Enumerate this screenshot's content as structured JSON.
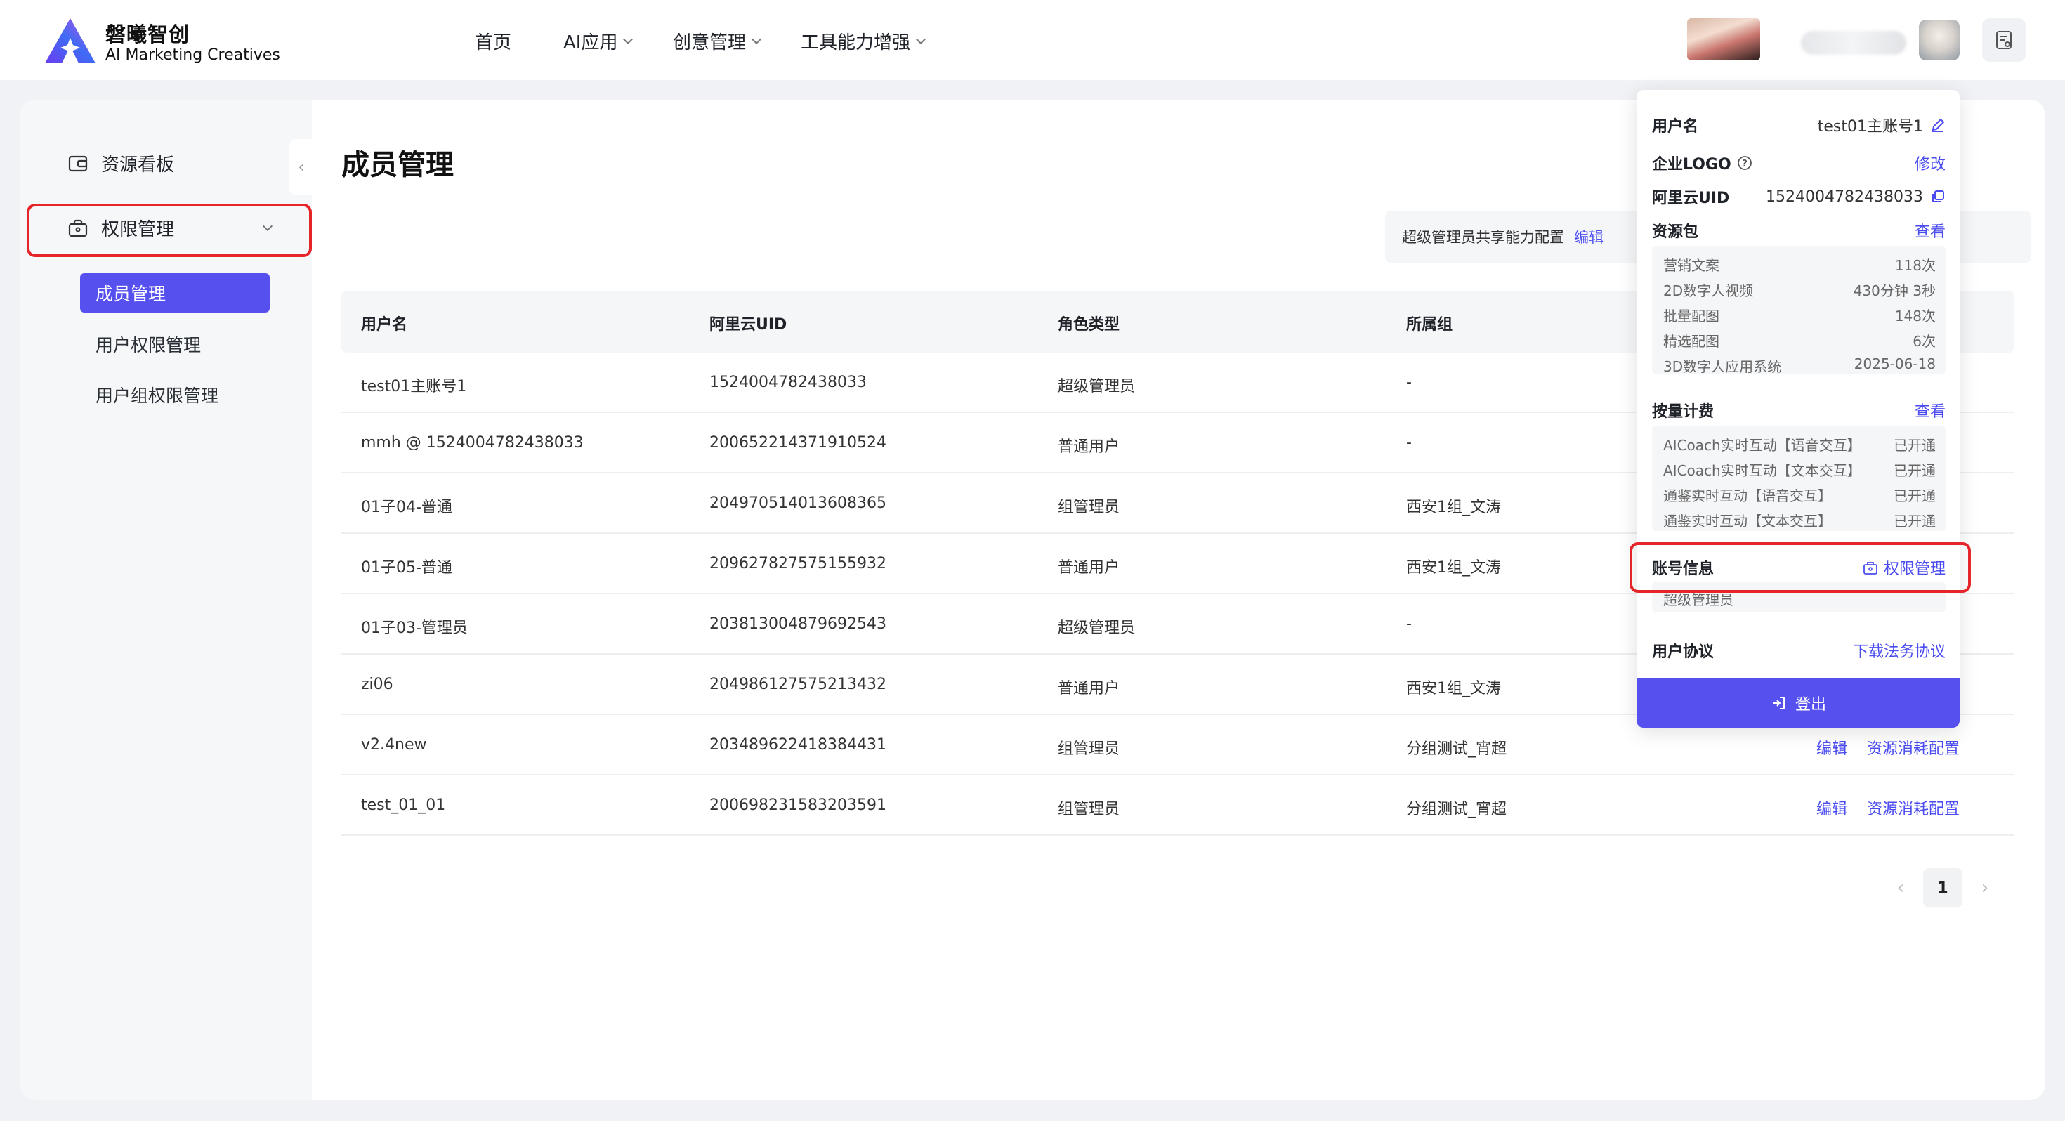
{
  "brand": {
    "name_cn": "磐曦智创",
    "name_en": "AI Marketing Creatives"
  },
  "nav": {
    "home": "首页",
    "ai_apps": "AI应用",
    "creative": "创意管理",
    "tools": "工具能力增强"
  },
  "sidebar": {
    "resource_board": "资源看板",
    "permission": "权限管理",
    "sub_items": [
      "成员管理",
      "用户权限管理",
      "用户组权限管理"
    ]
  },
  "page": {
    "title": "成员管理",
    "share_config": "超级管理员共享能力配置",
    "share_edit": "编辑"
  },
  "table": {
    "headers": [
      "用户名",
      "阿里云UID",
      "角色类型",
      "所属组"
    ],
    "rows": [
      {
        "user": "test01主账号1",
        "uid": "1524004782438033",
        "role": "超级管理员",
        "group": "-",
        "edit": "",
        "resource": ""
      },
      {
        "user": "mmh @ 1524004782438033",
        "uid": "200652214371910524",
        "role": "普通用户",
        "group": "-",
        "edit": "",
        "resource": ""
      },
      {
        "user": "01子04-普通",
        "uid": "204970514013608365",
        "role": "组管理员",
        "group": "西安1组_文涛",
        "edit": "",
        "resource": ""
      },
      {
        "user": "01子05-普通",
        "uid": "209627827575155932",
        "role": "普通用户",
        "group": "西安1组_文涛",
        "edit": "",
        "resource": ""
      },
      {
        "user": "01子03-管理员",
        "uid": "203813004879692543",
        "role": "超级管理员",
        "group": "-",
        "edit": "",
        "resource": ""
      },
      {
        "user": "zi06",
        "uid": "204986127575213432",
        "role": "普通用户",
        "group": "西安1组_文涛",
        "edit": "",
        "resource": ""
      },
      {
        "user": "v2.4new",
        "uid": "203489622418384431",
        "role": "组管理员",
        "group": "分组测试_宵超",
        "edit": "编辑",
        "resource": "资源消耗配置"
      },
      {
        "user": "test_01_01",
        "uid": "200698231583203591",
        "role": "组管理员",
        "group": "分组测试_宵超",
        "edit": "编辑",
        "resource": "资源消耗配置"
      }
    ]
  },
  "pagination": {
    "current": "1"
  },
  "dropdown": {
    "username_label": "用户名",
    "username_value": "test01主账号1",
    "logo_label": "企业LOGO",
    "logo_action": "修改",
    "uid_label": "阿里云UID",
    "uid_value": "1524004782438033",
    "resource_label": "资源包",
    "resource_action": "查看",
    "resources": [
      {
        "name": "营销文案",
        "value": "118次"
      },
      {
        "name": "2D数字人视频",
        "value": "430分钟 3秒"
      },
      {
        "name": "批量配图",
        "value": "148次"
      },
      {
        "name": "精选配图",
        "value": "6次"
      },
      {
        "name": "3D数字人应用系统",
        "value": "2025-06-18"
      }
    ],
    "billing_label": "按量计费",
    "billing_action": "查看",
    "billing": [
      {
        "name": "AICoach实时互动【语音交互】",
        "value": "已开通"
      },
      {
        "name": "AICoach实时互动【文本交互】",
        "value": "已开通"
      },
      {
        "name": "通鉴实时互动【语音交互】",
        "value": "已开通"
      },
      {
        "name": "通鉴实时互动【文本交互】",
        "value": "已开通"
      }
    ],
    "account_label": "账号信息",
    "account_action": "权限管理",
    "account_role": "超级管理员",
    "agreement_label": "用户协议",
    "agreement_action": "下载法务协议",
    "logout": "登出"
  },
  "colors": {
    "accent": "#5651ee",
    "highlight": "#e5252a",
    "link": "#4b4cf0"
  }
}
